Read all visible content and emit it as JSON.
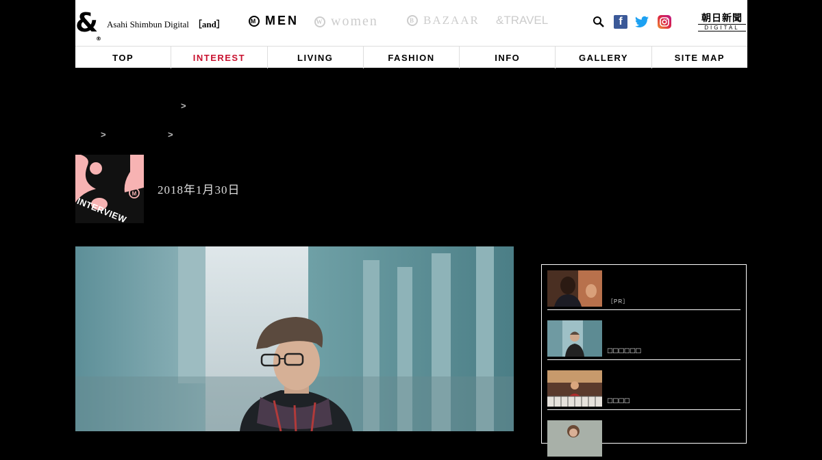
{
  "header": {
    "logo_mark": "&",
    "logo_reg": "®",
    "brand_text": "Asahi Shimbun Digital",
    "brand_tag": "［and］",
    "sites": [
      {
        "label": "MEN",
        "circle": "M"
      },
      {
        "label": "women",
        "circle": "W"
      },
      {
        "label": "BAZAAR",
        "circle": "B"
      },
      {
        "label": "&TRAVEL"
      }
    ],
    "asahi_logo_title": "朝日新聞",
    "asahi_logo_sub": "DIGITAL",
    "social_icons": [
      "search-icon",
      "facebook-icon",
      "twitter-icon",
      "instagram-icon"
    ]
  },
  "nav": {
    "items": [
      "TOP",
      "INTEREST",
      "LIVING",
      "FASHION",
      "INFO",
      "GALLERY",
      "SITE MAP"
    ],
    "active": "INTEREST",
    "active_color": "#c8102e"
  },
  "breadcrumb": {
    "separators": [
      ">",
      ">",
      ">"
    ]
  },
  "article": {
    "badge_text": "INTERVIEW",
    "badge_color": "#f7b3b3",
    "date": "2018年1月30日"
  },
  "sidebar": {
    "items": [
      {
        "caption": "",
        "tag": "［PR］"
      },
      {
        "caption": "□□□□□□"
      },
      {
        "caption": "□□□□"
      },
      {
        "caption": ""
      }
    ]
  }
}
